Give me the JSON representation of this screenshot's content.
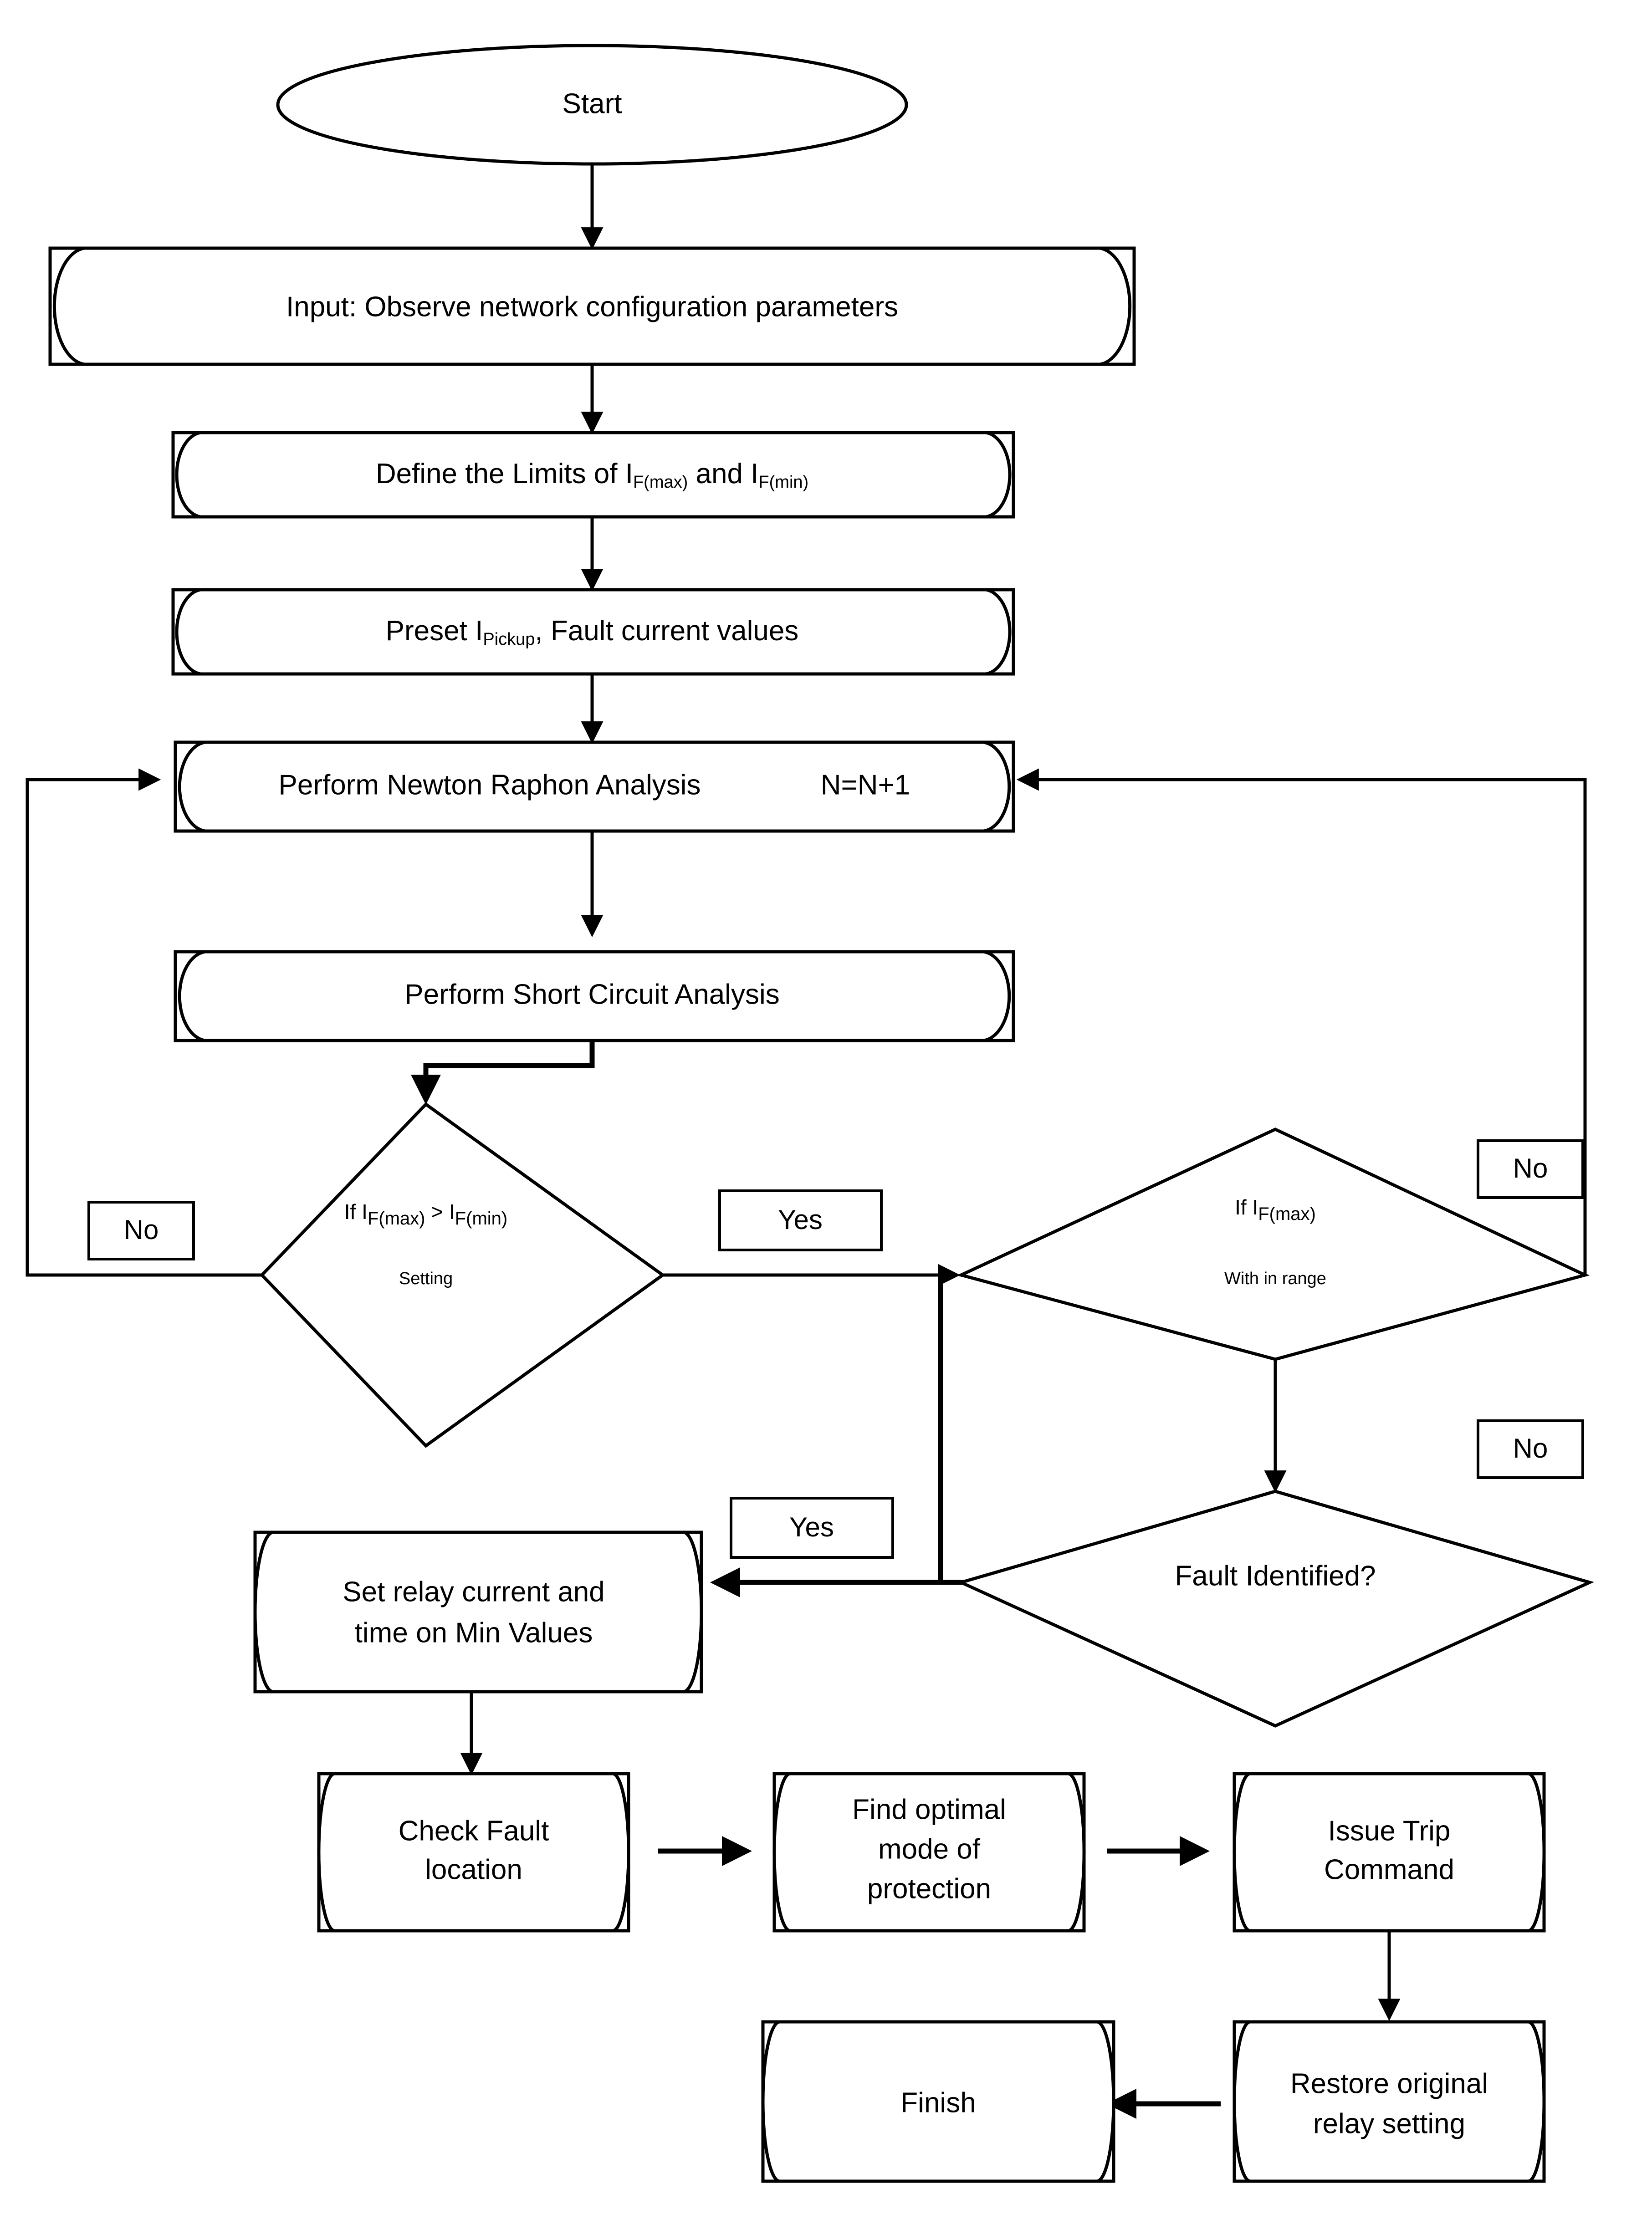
{
  "diagram": {
    "title": "Relay protection coordination flowchart",
    "background_color": "#ffffff",
    "line_color": "#000000"
  },
  "nodes": {
    "start": {
      "label": "Start",
      "shape": "ellipse"
    },
    "input_params": {
      "label": "Input: Observe network configuration parameters",
      "shape": "tape"
    },
    "define_limits": {
      "prefix": "Define the Limits of ",
      "sym1": "I",
      "sub1": "F(max)",
      "mid": " and ",
      "sym2": "I",
      "sub2": "F(min)",
      "shape": "tape"
    },
    "preset": {
      "prefix": "Preset ",
      "sym1": "I",
      "sub1": "Pickup",
      "suffix": ", Fault current values",
      "shape": "tape"
    },
    "newton_raphson": {
      "label": "Perform Newton Raphon Analysis",
      "counter": "N=N+1",
      "shape": "tape"
    },
    "short_circuit": {
      "label": "Perform Short Circuit Analysis",
      "shape": "tape"
    },
    "decision_limits": {
      "line1_prefix": "If ",
      "line1_sym1": "I",
      "line1_sub1": "F(max)",
      "line1_op": " > ",
      "line1_sym2": "I",
      "line1_sub2": "F(min)",
      "line2": "Setting",
      "shape": "diamond"
    },
    "decision_range": {
      "line1_prefix": "If ",
      "line1_sym1": "I",
      "line1_sub1": "F(max)",
      "line2": "With in range",
      "shape": "diamond"
    },
    "decision_fault": {
      "label": "Fault Identified?",
      "shape": "diamond"
    },
    "set_relay": {
      "line1": "Set relay current and",
      "line2": "time on Min Values",
      "shape": "tape"
    },
    "check_fault": {
      "line1": "Check Fault",
      "line2": "location",
      "shape": "tape"
    },
    "find_optimal": {
      "line1": "Find optimal",
      "line2": "mode of",
      "line3": "protection",
      "shape": "tape"
    },
    "issue_trip": {
      "line1": "Issue Trip",
      "line2": "Command",
      "shape": "tape"
    },
    "restore": {
      "line1": "Restore original",
      "line2": "relay setting",
      "shape": "tape"
    },
    "finish": {
      "label": "Finish",
      "shape": "tape"
    }
  },
  "edge_labels": {
    "no_limits": "No",
    "yes_limits": "Yes",
    "no_range": "No",
    "no_fault": "No",
    "yes_fault": "Yes"
  }
}
